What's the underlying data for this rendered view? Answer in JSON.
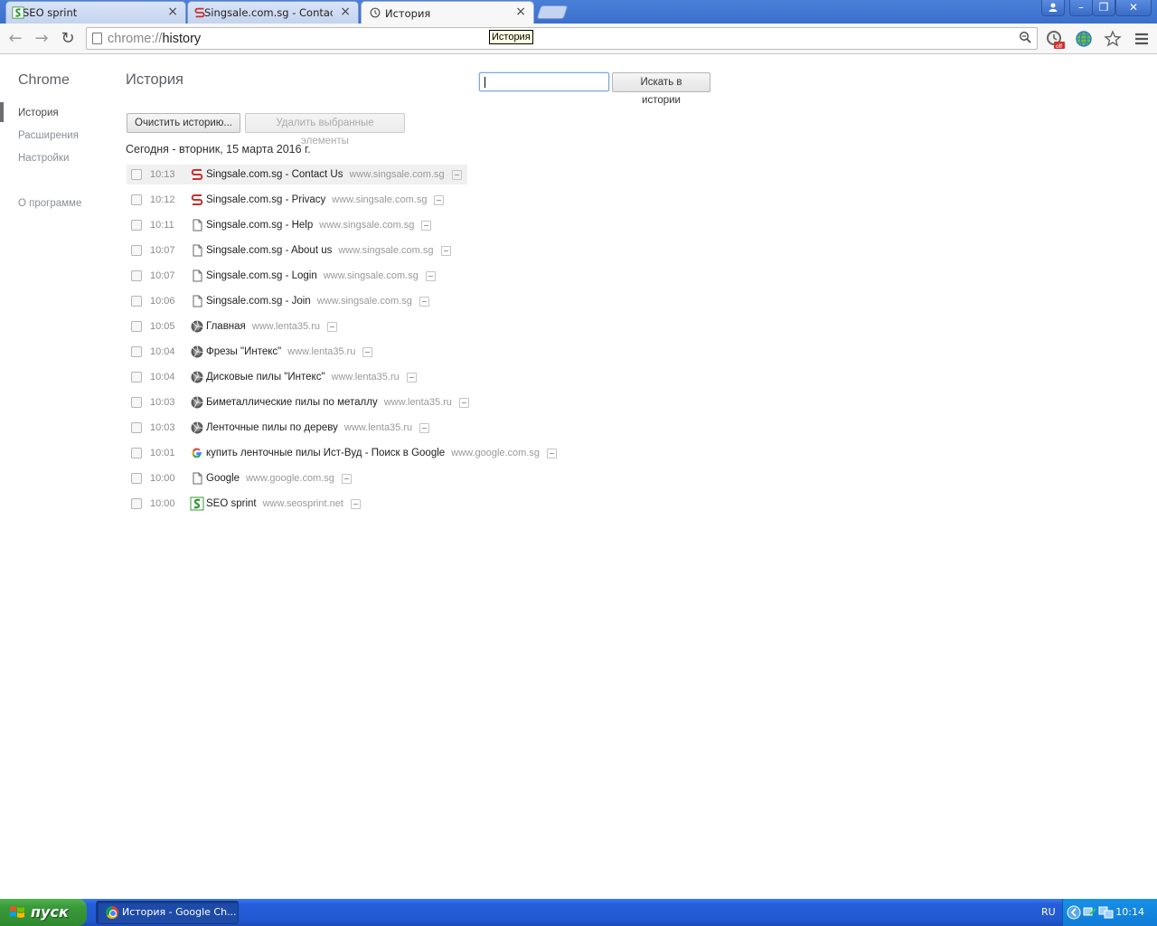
{
  "browser": {
    "tabs": [
      {
        "title": "SEO sprint",
        "icon": "seosprint-icon",
        "active": false
      },
      {
        "title": "Singsale.com.sg - Contact Us",
        "icon": "singsale-icon",
        "active": false
      },
      {
        "title": "История",
        "icon": "history-icon",
        "active": true
      }
    ],
    "url_scheme": "chrome://",
    "url_path": "history",
    "tooltip": "История"
  },
  "sidebar": {
    "brand": "Chrome",
    "items": [
      {
        "label": "История",
        "selected": true
      },
      {
        "label": "Расширения",
        "selected": false
      },
      {
        "label": "Настройки",
        "selected": false
      }
    ],
    "about": "О программе"
  },
  "main": {
    "title": "История",
    "search_button": "Искать в истории",
    "clear_button": "Очистить историю...",
    "delete_button": "Удалить выбранные элементы",
    "day_header": "Сегодня - вторник, 15 марта 2016 г."
  },
  "history": [
    {
      "time": "10:13",
      "title": "Singsale.com.sg - Contact Us",
      "domain": "www.singsale.com.sg",
      "icon": "singsale"
    },
    {
      "time": "10:12",
      "title": "Singsale.com.sg - Privacy",
      "domain": "www.singsale.com.sg",
      "icon": "singsale"
    },
    {
      "time": "10:11",
      "title": "Singsale.com.sg - Help",
      "domain": "www.singsale.com.sg",
      "icon": "page"
    },
    {
      "time": "10:07",
      "title": "Singsale.com.sg - About us",
      "domain": "www.singsale.com.sg",
      "icon": "page"
    },
    {
      "time": "10:07",
      "title": "Singsale.com.sg - Login",
      "domain": "www.singsale.com.sg",
      "icon": "page"
    },
    {
      "time": "10:06",
      "title": "Singsale.com.sg - Join",
      "domain": "www.singsale.com.sg",
      "icon": "page"
    },
    {
      "time": "10:05",
      "title": "Главная",
      "domain": "www.lenta35.ru",
      "icon": "saw"
    },
    {
      "time": "10:04",
      "title": "Фрезы \"Интекс\"",
      "domain": "www.lenta35.ru",
      "icon": "saw"
    },
    {
      "time": "10:04",
      "title": "Дисковые пилы \"Интекс\"",
      "domain": "www.lenta35.ru",
      "icon": "saw"
    },
    {
      "time": "10:03",
      "title": "Биметаллические пилы по металлу",
      "domain": "www.lenta35.ru",
      "icon": "saw"
    },
    {
      "time": "10:03",
      "title": "Ленточные пилы по дереву",
      "domain": "www.lenta35.ru",
      "icon": "saw"
    },
    {
      "time": "10:01",
      "title": "купить ленточные пилы Ист-Вуд - Поиск в Google",
      "domain": "www.google.com.sg",
      "icon": "google"
    },
    {
      "time": "10:00",
      "title": "Google",
      "domain": "www.google.com.sg",
      "icon": "page"
    },
    {
      "time": "10:00",
      "title": "SEO sprint",
      "domain": "www.seosprint.net",
      "icon": "seosprint"
    }
  ],
  "taskbar": {
    "start_label": "пуск",
    "task_label": "История - Google Ch...",
    "language": "RU",
    "clock": "10:14"
  }
}
